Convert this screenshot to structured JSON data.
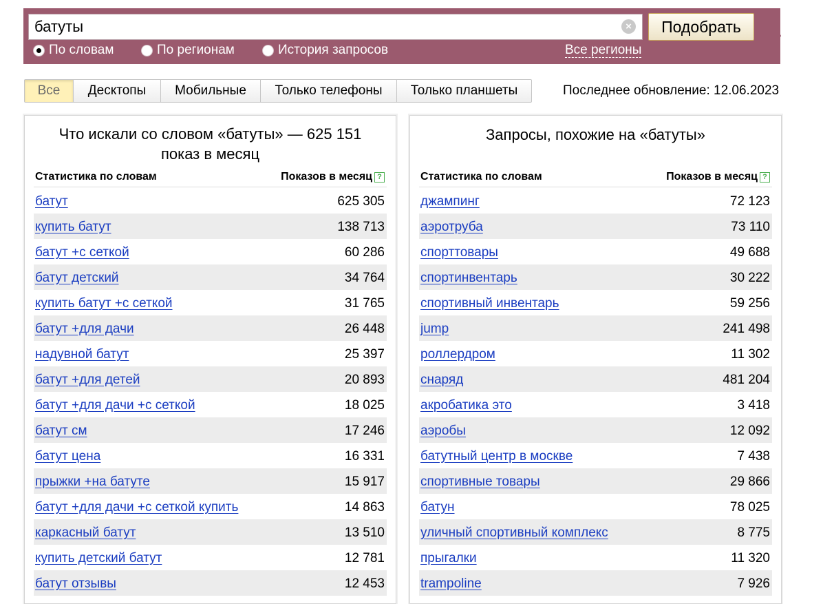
{
  "search": {
    "query": "батуты",
    "button_label": "Подобрать",
    "modes": [
      {
        "label": "По словам",
        "checked": true
      },
      {
        "label": "По регионам",
        "checked": false
      },
      {
        "label": "История запросов",
        "checked": false
      }
    ],
    "region_link": "Все регионы"
  },
  "tabs": [
    {
      "label": "Все",
      "active": true
    },
    {
      "label": "Десктопы",
      "active": false
    },
    {
      "label": "Мобильные",
      "active": false
    },
    {
      "label": "Только телефоны",
      "active": false
    },
    {
      "label": "Только планшеты",
      "active": false
    }
  ],
  "last_update": "Последнее обновление: 12.06.2023",
  "left_panel": {
    "title": "Что искали со словом «батуты» — 625 151 показ в месяц",
    "col_words": "Статистика по словам",
    "col_count": "Показов в месяц",
    "rows": [
      {
        "phrase": "батут",
        "count": "625 305"
      },
      {
        "phrase": "купить батут",
        "count": "138 713"
      },
      {
        "phrase": "батут +с сеткой",
        "count": "60 286"
      },
      {
        "phrase": "батут детский",
        "count": "34 764"
      },
      {
        "phrase": "купить батут +с сеткой",
        "count": "31 765"
      },
      {
        "phrase": "батут +для дачи",
        "count": "26 448"
      },
      {
        "phrase": "надувной батут",
        "count": "25 397"
      },
      {
        "phrase": "батут +для детей",
        "count": "20 893"
      },
      {
        "phrase": "батут +для дачи +с сеткой",
        "count": "18 025"
      },
      {
        "phrase": "батут см",
        "count": "17 246"
      },
      {
        "phrase": "батут цена",
        "count": "16 331"
      },
      {
        "phrase": "прыжки +на батуте",
        "count": "15 917"
      },
      {
        "phrase": "батут +для дачи +с сеткой купить",
        "count": "14 863"
      },
      {
        "phrase": "каркасный батут",
        "count": "13 510"
      },
      {
        "phrase": "купить детский батут",
        "count": "12 781"
      },
      {
        "phrase": "батут отзывы",
        "count": "12 453"
      }
    ]
  },
  "right_panel": {
    "title": "Запросы, похожие на «батуты»",
    "col_words": "Статистика по словам",
    "col_count": "Показов в месяц",
    "rows": [
      {
        "phrase": "джампинг",
        "count": "72 123"
      },
      {
        "phrase": "аэротруба",
        "count": "73 110"
      },
      {
        "phrase": "спорттовары",
        "count": "49 688"
      },
      {
        "phrase": "спортинвентарь",
        "count": "30 222"
      },
      {
        "phrase": "спортивный инвентарь",
        "count": "59 256"
      },
      {
        "phrase": "jump",
        "count": "241 498"
      },
      {
        "phrase": "роллердром",
        "count": "11 302"
      },
      {
        "phrase": "снаряд",
        "count": "481 204"
      },
      {
        "phrase": "акробатика это",
        "count": "3 418"
      },
      {
        "phrase": "аэробы",
        "count": "12 092"
      },
      {
        "phrase": "батутный центр в москве",
        "count": "7 438"
      },
      {
        "phrase": "спортивные товары",
        "count": "29 866"
      },
      {
        "phrase": "батун",
        "count": "78 025"
      },
      {
        "phrase": "уличный спортивный комплекс",
        "count": "8 775"
      },
      {
        "phrase": "прыгалки",
        "count": "11 320"
      },
      {
        "phrase": "trampoline",
        "count": "7 926"
      }
    ]
  }
}
